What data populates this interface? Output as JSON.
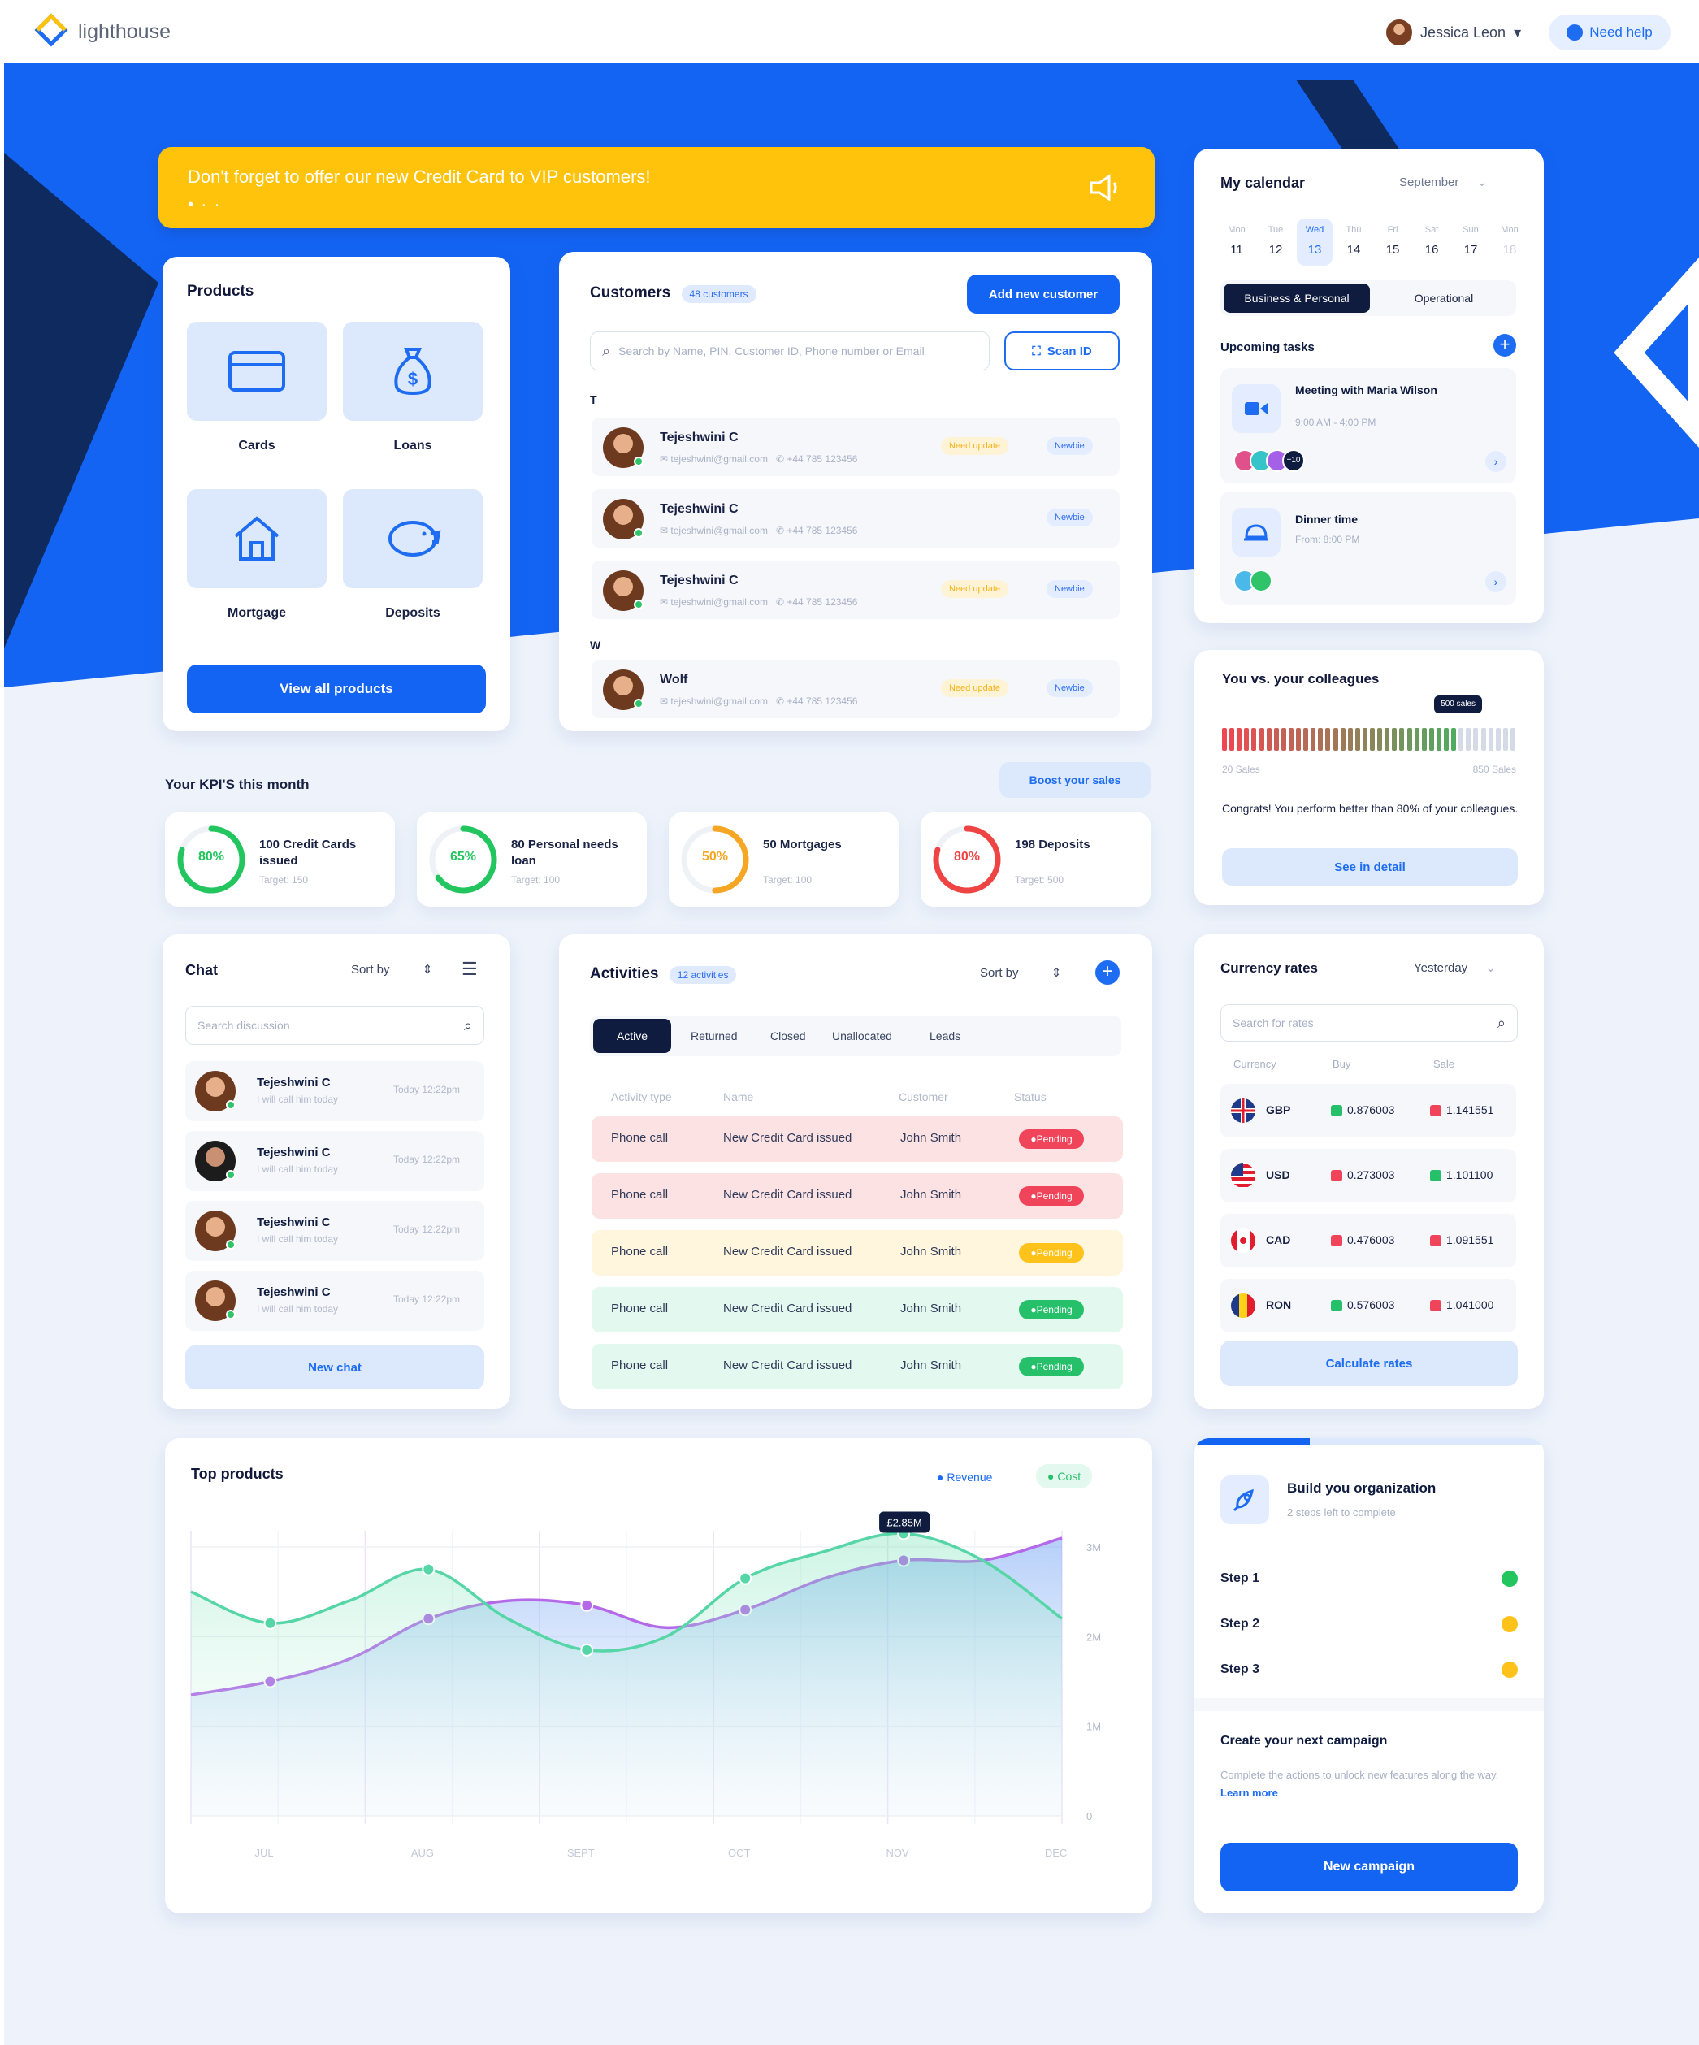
{
  "app": {
    "brand": "lighthouse",
    "user_name": "Jessica Leon",
    "help_label": "Need help"
  },
  "banner": {
    "text": "Don't forget to offer our new  Credit Card to VIP customers!",
    "dots": "• · ·"
  },
  "products": {
    "title": "Products",
    "items": [
      {
        "label": "Cards"
      },
      {
        "label": "Loans"
      },
      {
        "label": "Mortgage"
      },
      {
        "label": "Deposits"
      }
    ],
    "button_label": "View all products"
  },
  "customers": {
    "title": "Customers",
    "count_badge": "48 customers",
    "add_label": "Add new customer",
    "search_placeholder": "Search by Name, PIN, Customer ID, Phone number or Email",
    "scan_label": "Scan ID",
    "groups": [
      {
        "letter": "T"
      },
      {
        "letter": "W"
      }
    ],
    "rows": [
      {
        "name": "Tejeshwini C",
        "email": "tejeshwini@gmail.com",
        "phone": "+44 785 123456",
        "tag_update": "Need update",
        "tag_new": "Newbie"
      },
      {
        "name": "Tejeshwini C",
        "email": "tejeshwini@gmail.com",
        "phone": "+44 785 123456",
        "tag_update": "",
        "tag_new": "Newbie"
      },
      {
        "name": "Tejeshwini C",
        "email": "tejeshwini@gmail.com",
        "phone": "+44 785 123456",
        "tag_update": "Need update",
        "tag_new": "Newbie"
      },
      {
        "name": "Wolf",
        "email": "tejeshwini@gmail.com",
        "phone": "+44 785 123456",
        "tag_update": "Need update",
        "tag_new": "Newbie"
      }
    ]
  },
  "kpis": {
    "title": "Your KPI'S this month",
    "boost_label": "Boost your sales",
    "items": [
      {
        "percent_label": "80%",
        "value": 0.8,
        "color": "#22c55e",
        "title": "100 Credit Cards issued",
        "target": "Target: 150"
      },
      {
        "percent_label": "65%",
        "value": 0.65,
        "color": "#22c55e",
        "title": "80 Personal needs loan",
        "target": "Target: 100"
      },
      {
        "percent_label": "50%",
        "value": 0.5,
        "color": "#f5a623",
        "title": "50 Mortgages",
        "target": "Target: 100"
      },
      {
        "percent_label": "80%",
        "value": 0.8,
        "color": "#ef4444",
        "title": "198 Deposits",
        "target": "Target: 500"
      }
    ]
  },
  "calendar": {
    "title": "My calendar",
    "month": "September",
    "days": [
      {
        "dow": "Mon",
        "num": "11"
      },
      {
        "dow": "Tue",
        "num": "12"
      },
      {
        "dow": "Wed",
        "num": "13"
      },
      {
        "dow": "Thu",
        "num": "14"
      },
      {
        "dow": "Fri",
        "num": "15"
      },
      {
        "dow": "Sat",
        "num": "16"
      },
      {
        "dow": "Sun",
        "num": "17"
      },
      {
        "dow": "Mon",
        "num": "18"
      }
    ],
    "tabs": [
      "Business & Personal",
      "Operational"
    ],
    "upcoming_title": "Upcoming tasks",
    "tasks": [
      {
        "title": "Meeting with Maria Wilson",
        "time": "9:00 AM - 4:00 PM",
        "more": "+10"
      },
      {
        "title": "Dinner time",
        "time": "From: 8:00 PM",
        "more": ""
      }
    ]
  },
  "colleagues": {
    "title": "You vs. your colleagues",
    "marker_label": "500 sales",
    "min_label": "20 Sales",
    "max_label": "850 Sales",
    "position": 0.8,
    "message": "Congrats! You perform better than 80% of your colleagues.",
    "button_label": "See in detail"
  },
  "chat": {
    "title": "Chat",
    "sort_label": "Sort by",
    "search_placeholder": "Search discussion",
    "items": [
      {
        "name": "Tejeshwini C",
        "message": "I will call him today",
        "time": "Today 12:22pm"
      },
      {
        "name": "Tejeshwini C",
        "message": "I will call him today",
        "time": "Today 12:22pm"
      },
      {
        "name": "Tejeshwini C",
        "message": "I will call him today",
        "time": "Today 12:22pm"
      },
      {
        "name": "Tejeshwini C",
        "message": "I will call him today",
        "time": "Today 12:22pm"
      }
    ],
    "button_label": "New chat"
  },
  "activities": {
    "title": "Activities",
    "count_badge": "12 activities",
    "sort_label": "Sort by",
    "tabs": [
      "Active",
      "Returned",
      "Closed",
      "Unallocated",
      "Leads"
    ],
    "columns": [
      "Activity type",
      "Name",
      "Customer",
      "Status"
    ],
    "rows": [
      {
        "type": "Phone call",
        "name": "New Credit Card issued",
        "customer": "John Smith",
        "status": "Pending",
        "bg": "#fde2e4",
        "pill": "#f0445a"
      },
      {
        "type": "Phone call",
        "name": "New Credit Card issued",
        "customer": "John Smith",
        "status": "Pending",
        "bg": "#fde2e4",
        "pill": "#f0445a"
      },
      {
        "type": "Phone call",
        "name": "New Credit Card issued",
        "customer": "John Smith",
        "status": "Pending",
        "bg": "#fff6dd",
        "pill": "#ffc21a"
      },
      {
        "type": "Phone call",
        "name": "New Credit Card issued",
        "customer": "John Smith",
        "status": "Pending",
        "bg": "#e3f8ee",
        "pill": "#26c06b"
      },
      {
        "type": "Phone call",
        "name": "New Credit Card issued",
        "customer": "John Smith",
        "status": "Pending",
        "bg": "#e3f8ee",
        "pill": "#26c06b"
      }
    ]
  },
  "currency": {
    "title": "Currency rates",
    "period": "Yesterday",
    "search_placeholder": "Search for rates",
    "columns": [
      "Currency",
      "Buy",
      "Sale"
    ],
    "rows": [
      {
        "code": "GBP",
        "buy": "0.876003",
        "sale": "1.141551",
        "buy_up": true,
        "sale_up": false
      },
      {
        "code": "USD",
        "buy": "0.273003",
        "sale": "1.101100",
        "buy_up": false,
        "sale_up": true
      },
      {
        "code": "CAD",
        "buy": "0.476003",
        "sale": "1.091551",
        "buy_up": false,
        "sale_up": false
      },
      {
        "code": "RON",
        "buy": "0.576003",
        "sale": "1.041000",
        "buy_up": true,
        "sale_up": false
      }
    ],
    "button_label": "Calculate rates"
  },
  "organization": {
    "progress": 0.33,
    "title": "Build you organization",
    "subtitle": "2 steps left to complete",
    "steps": [
      {
        "label": "Step 1",
        "color": "#22c55e"
      },
      {
        "label": "Step 2",
        "color": "#ffc21a"
      },
      {
        "label": "Step 3",
        "color": "#ffc21a"
      }
    ],
    "campaign_title": "Create your next campaign",
    "campaign_text": "Complete the actions to unlock new features along the way.",
    "learn_more": "Learn more",
    "button_label": "New campaign"
  },
  "chart_data": {
    "type": "area",
    "title": "Top products",
    "categories": [
      "JUL",
      "AUG",
      "SEPT",
      "OCT",
      "NOV",
      "DEC"
    ],
    "y_ticks": [
      "0",
      "1M",
      "2M",
      "3M"
    ],
    "ylim": [
      0,
      3000000
    ],
    "legend": [
      "Revenue",
      "Cost"
    ],
    "annotation": "£2.85M",
    "x": [
      0,
      0.5,
      1,
      1.5,
      2,
      2.5,
      3,
      3.5,
      4,
      4.5,
      5,
      5.5
    ],
    "series": [
      {
        "name": "Revenue",
        "color": "#b46ae8",
        "values": [
          1350000,
          1500000,
          1750000,
          2200000,
          2400000,
          2350000,
          2100000,
          2300000,
          2650000,
          2850000,
          2850000,
          3100000
        ]
      },
      {
        "name": "Cost",
        "color": "#56d6a6",
        "values": [
          2500000,
          2150000,
          2400000,
          2750000,
          2200000,
          1850000,
          2000000,
          2650000,
          2950000,
          3150000,
          2850000,
          2200000
        ]
      }
    ]
  }
}
